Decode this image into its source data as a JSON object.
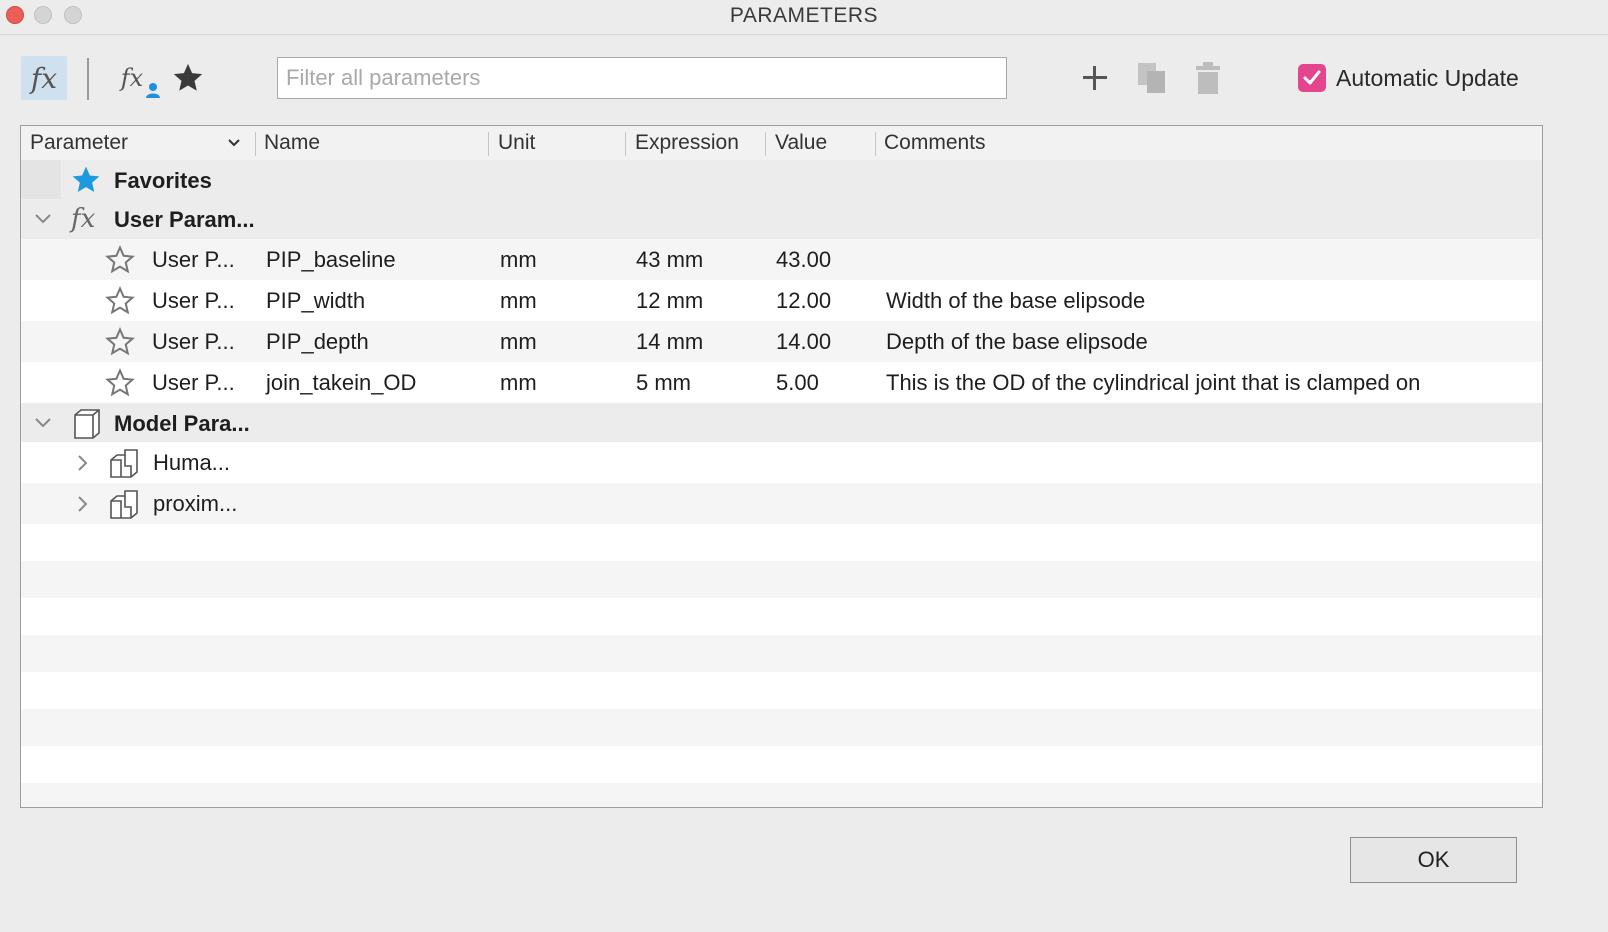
{
  "window": {
    "title": "PARAMETERS"
  },
  "toolbar": {
    "fx_glyph": "fx",
    "filter_placeholder": "Filter all parameters",
    "filter_value": "",
    "auto_update_label": "Automatic Update",
    "auto_update_checked": true,
    "accent_color": "#e5458d",
    "icons": [
      "fx-icon",
      "user-parameter-icon",
      "favorites-star-icon",
      "add-icon",
      "copy-icon",
      "delete-icon"
    ]
  },
  "table": {
    "headers": [
      "Parameter",
      "Name",
      "Unit",
      "Expression",
      "Value",
      "Comments"
    ],
    "groups": {
      "favorites": "Favorites",
      "user": "User Param...",
      "model": "Model Para..."
    },
    "user_rows": [
      {
        "param": "User P...",
        "name": "PIP_baseline",
        "unit": "mm",
        "expression": "43 mm",
        "value": "43.00",
        "comment": ""
      },
      {
        "param": "User P...",
        "name": "PIP_width",
        "unit": "mm",
        "expression": "12 mm",
        "value": "12.00",
        "comment": "Width of the base elipsode"
      },
      {
        "param": "User P...",
        "name": "PIP_depth",
        "unit": "mm",
        "expression": "14 mm",
        "value": "14.00",
        "comment": "Depth of the base elipsode"
      },
      {
        "param": "User P...",
        "name": "join_takein_OD",
        "unit": "mm",
        "expression": "5 mm",
        "value": "5.00",
        "comment": "This is the OD of the cylindrical joint that is clamped on"
      }
    ],
    "model_rows": [
      {
        "label": "Huma..."
      },
      {
        "label": "proxim..."
      }
    ]
  },
  "footer": {
    "ok_label": "OK"
  }
}
